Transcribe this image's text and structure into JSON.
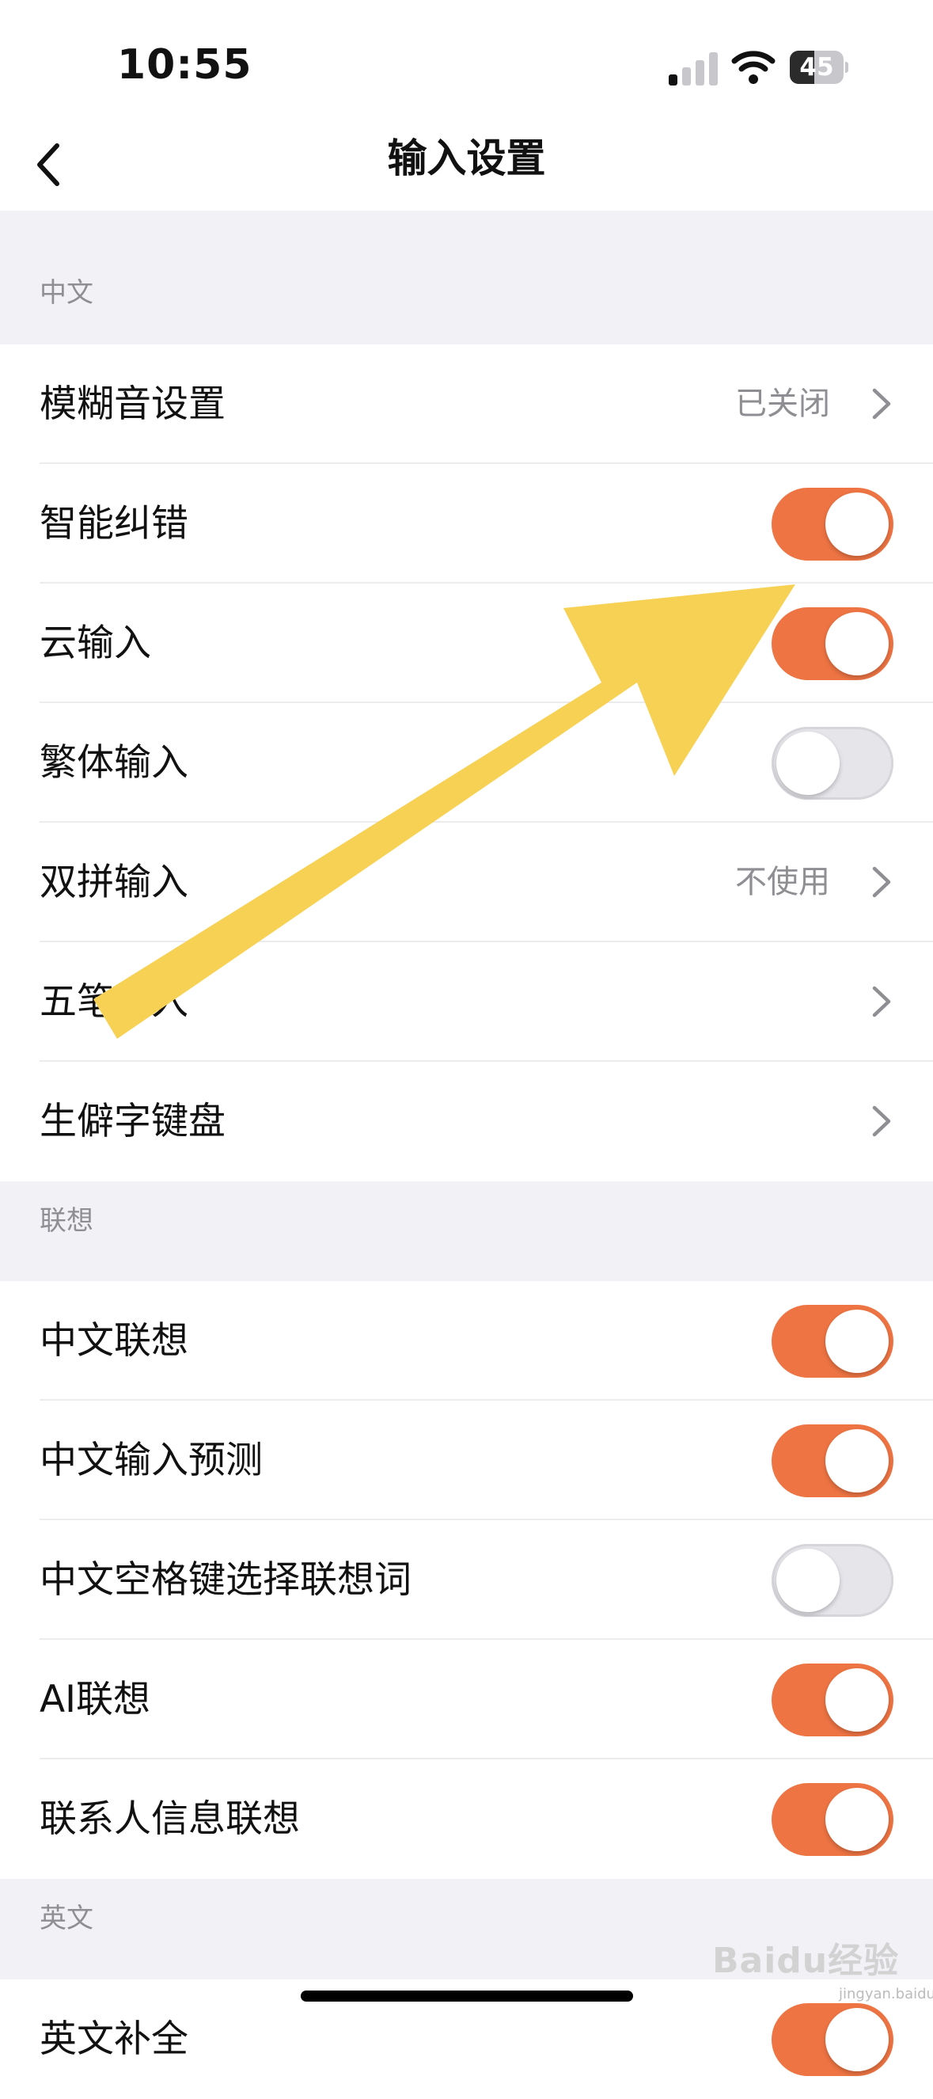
{
  "status_bar": {
    "time": "10:55",
    "battery": "45",
    "battery_level": 0.45
  },
  "nav": {
    "title": "输入设置",
    "back_icon": "chevron-left-icon"
  },
  "sections": [
    {
      "title": "中文",
      "rows": [
        {
          "label": "模糊音设置",
          "type": "link",
          "value": "已关闭"
        },
        {
          "label": "智能纠错",
          "type": "toggle",
          "on": true
        },
        {
          "label": "云输入",
          "type": "toggle",
          "on": true
        },
        {
          "label": "繁体输入",
          "type": "toggle",
          "on": false
        },
        {
          "label": "双拼输入",
          "type": "link",
          "value": "不使用"
        },
        {
          "label": "五笔输入",
          "type": "link",
          "value": ""
        },
        {
          "label": "生僻字键盘",
          "type": "link",
          "value": ""
        }
      ]
    },
    {
      "title": "联想",
      "rows": [
        {
          "label": "中文联想",
          "type": "toggle",
          "on": true
        },
        {
          "label": "中文输入预测",
          "type": "toggle",
          "on": true
        },
        {
          "label": "中文空格键选择联想词",
          "type": "toggle",
          "on": false
        },
        {
          "label": "AI联想",
          "type": "toggle",
          "on": true
        },
        {
          "label": "联系人信息联想",
          "type": "toggle",
          "on": true
        }
      ]
    },
    {
      "title": "英文",
      "rows": [
        {
          "label": "英文补全",
          "type": "toggle",
          "on": true
        }
      ]
    }
  ],
  "colors": {
    "accent": "#ee7443",
    "annotation_arrow": "#f7d154"
  },
  "watermark": {
    "brand": "Baidu经验",
    "url": "jingyan.baidu.com"
  }
}
